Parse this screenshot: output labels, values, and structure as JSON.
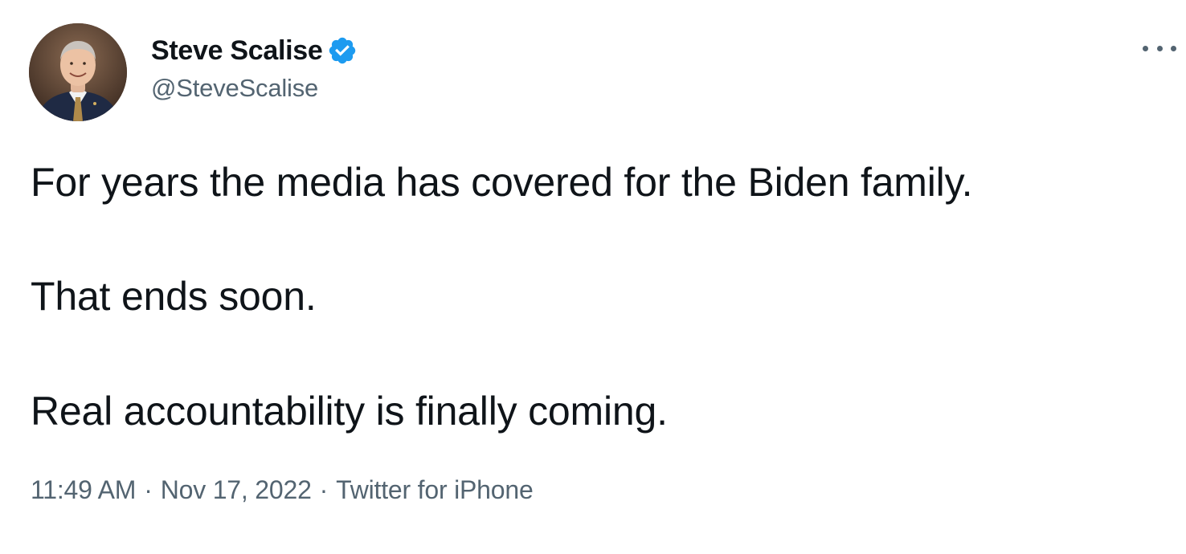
{
  "author": {
    "display_name": "Steve Scalise",
    "handle": "@SteveScalise",
    "verified_icon": "verified-badge-icon",
    "verified_color": "#1d9bf0"
  },
  "tweet": {
    "lines": [
      "For years the media has covered for the Biden family.",
      "That ends soon.",
      "Real accountability is finally coming."
    ],
    "time": "11:49 AM",
    "separator": "·",
    "date": "Nov 17, 2022",
    "source": "Twitter for iPhone"
  },
  "menu": {
    "icon": "more-options-icon"
  },
  "colors": {
    "text_primary": "#0f1419",
    "text_secondary": "#536471",
    "background": "#ffffff"
  }
}
